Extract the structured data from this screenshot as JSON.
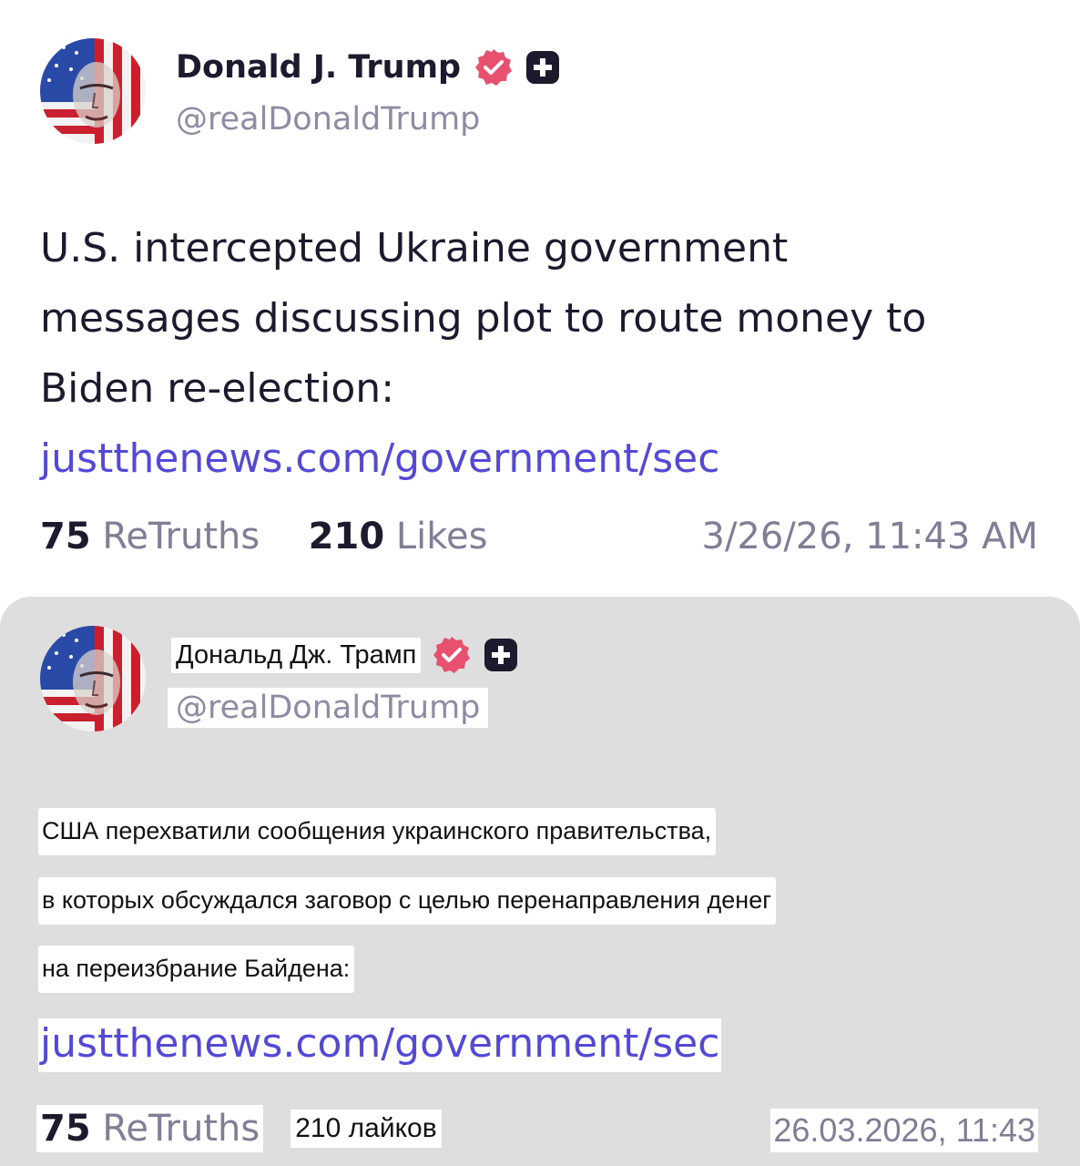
{
  "original": {
    "author": {
      "name": "Donald J. Trump",
      "handle": "@realDonaldTrump",
      "avatar_icon": "flag-portrait-avatar",
      "verified_icon": "verified-badge-icon",
      "plus_icon": "truth-plus-icon"
    },
    "body_lines": [
      "U.S. intercepted Ukraine government",
      "messages discussing plot to route money to",
      "Biden re-election:"
    ],
    "link": "justthenews.com/government/sec",
    "retruths_count": "75",
    "retruths_label": "ReTruths",
    "likes_count": "210",
    "likes_label": "Likes",
    "timestamp": "3/26/26, 11:43 AM"
  },
  "translation": {
    "author": {
      "name": "Дональд Дж. Трамп",
      "handle": "@realDonaldTrump"
    },
    "body_lines": [
      "США перехватили сообщения украинского правительства,",
      "в которых обсуждался заговор с целью перенаправления денег",
      "на переизбрание Байдена:"
    ],
    "link": "justthenews.com/government/sec",
    "retruths_count": "75",
    "retruths_label": "ReTruths",
    "likes_text": "210 лайков",
    "timestamp": "26.03.2026, 11:43"
  },
  "colors": {
    "text": "#1c1b2e",
    "muted": "#8d8ca0",
    "link": "#5448d6",
    "badge": "#e8506f",
    "translation_bg": "#dedede"
  }
}
